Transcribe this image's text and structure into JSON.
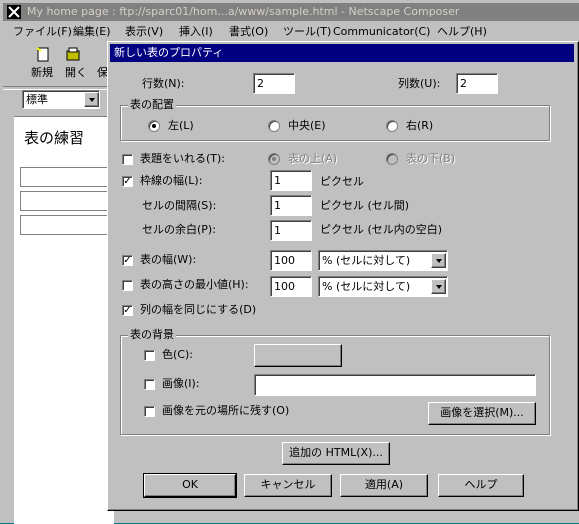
{
  "window": {
    "title": "My home page : ftp://sparc01/hom...a/www/sample.html - Netscape Composer",
    "menu": [
      "ファイル(F)",
      "編集(E)",
      "表示(V)",
      "挿入(I)",
      "書式(O)",
      "ツール(T)",
      "Communicator(C)",
      "ヘルプ(H)"
    ],
    "toolbar": [
      "新規",
      "開く",
      "保"
    ],
    "style_select": "標準",
    "doc_text": "表の練習"
  },
  "dialog": {
    "title": "新しい表のプロパティ",
    "rows_label": "行数(N):",
    "rows_value": "2",
    "cols_label": "列数(U):",
    "cols_value": "2",
    "align_group": "表の配置",
    "align_left": "左(L)",
    "align_center": "中央(E)",
    "align_right": "右(R)",
    "caption_label": "表題をいれる(T):",
    "caption_above": "表の上(A)",
    "caption_below": "表の下(B)",
    "border_label": "枠線の幅(L):",
    "border_value": "1",
    "border_unit": "ピクセル",
    "spacing_label": "セルの間隔(S):",
    "spacing_value": "1",
    "spacing_unit": "ピクセル (セル間)",
    "padding_label": "セルの余白(P):",
    "padding_value": "1",
    "padding_unit": "ピクセル (セル内の空白)",
    "width_label": "表の幅(W):",
    "width_value": "100",
    "width_unit": "% (セルに対して)",
    "height_label": "表の高さの最小値(H):",
    "height_value": "100",
    "height_unit": "% (セルに対して)",
    "equal_cols_label": "列の幅を同じにする(D)",
    "bg_group": "表の背景",
    "color_label": "色(C):",
    "image_label": "画像(I):",
    "image_value": "",
    "keep_image_label": "画像を元の場所に残す(O)",
    "choose_image_button": "画像を選択(M)...",
    "extra_html_button": "追加の HTML(X)...",
    "ok_button": "OK",
    "cancel_button": "キャンセル",
    "apply_button": "適用(A)",
    "help_button": "ヘルプ",
    "state": {
      "align": "left",
      "caption": false,
      "border": true,
      "width": true,
      "min_height": false,
      "equal_cols": true,
      "color": false,
      "image": false,
      "keep_image": false
    }
  }
}
